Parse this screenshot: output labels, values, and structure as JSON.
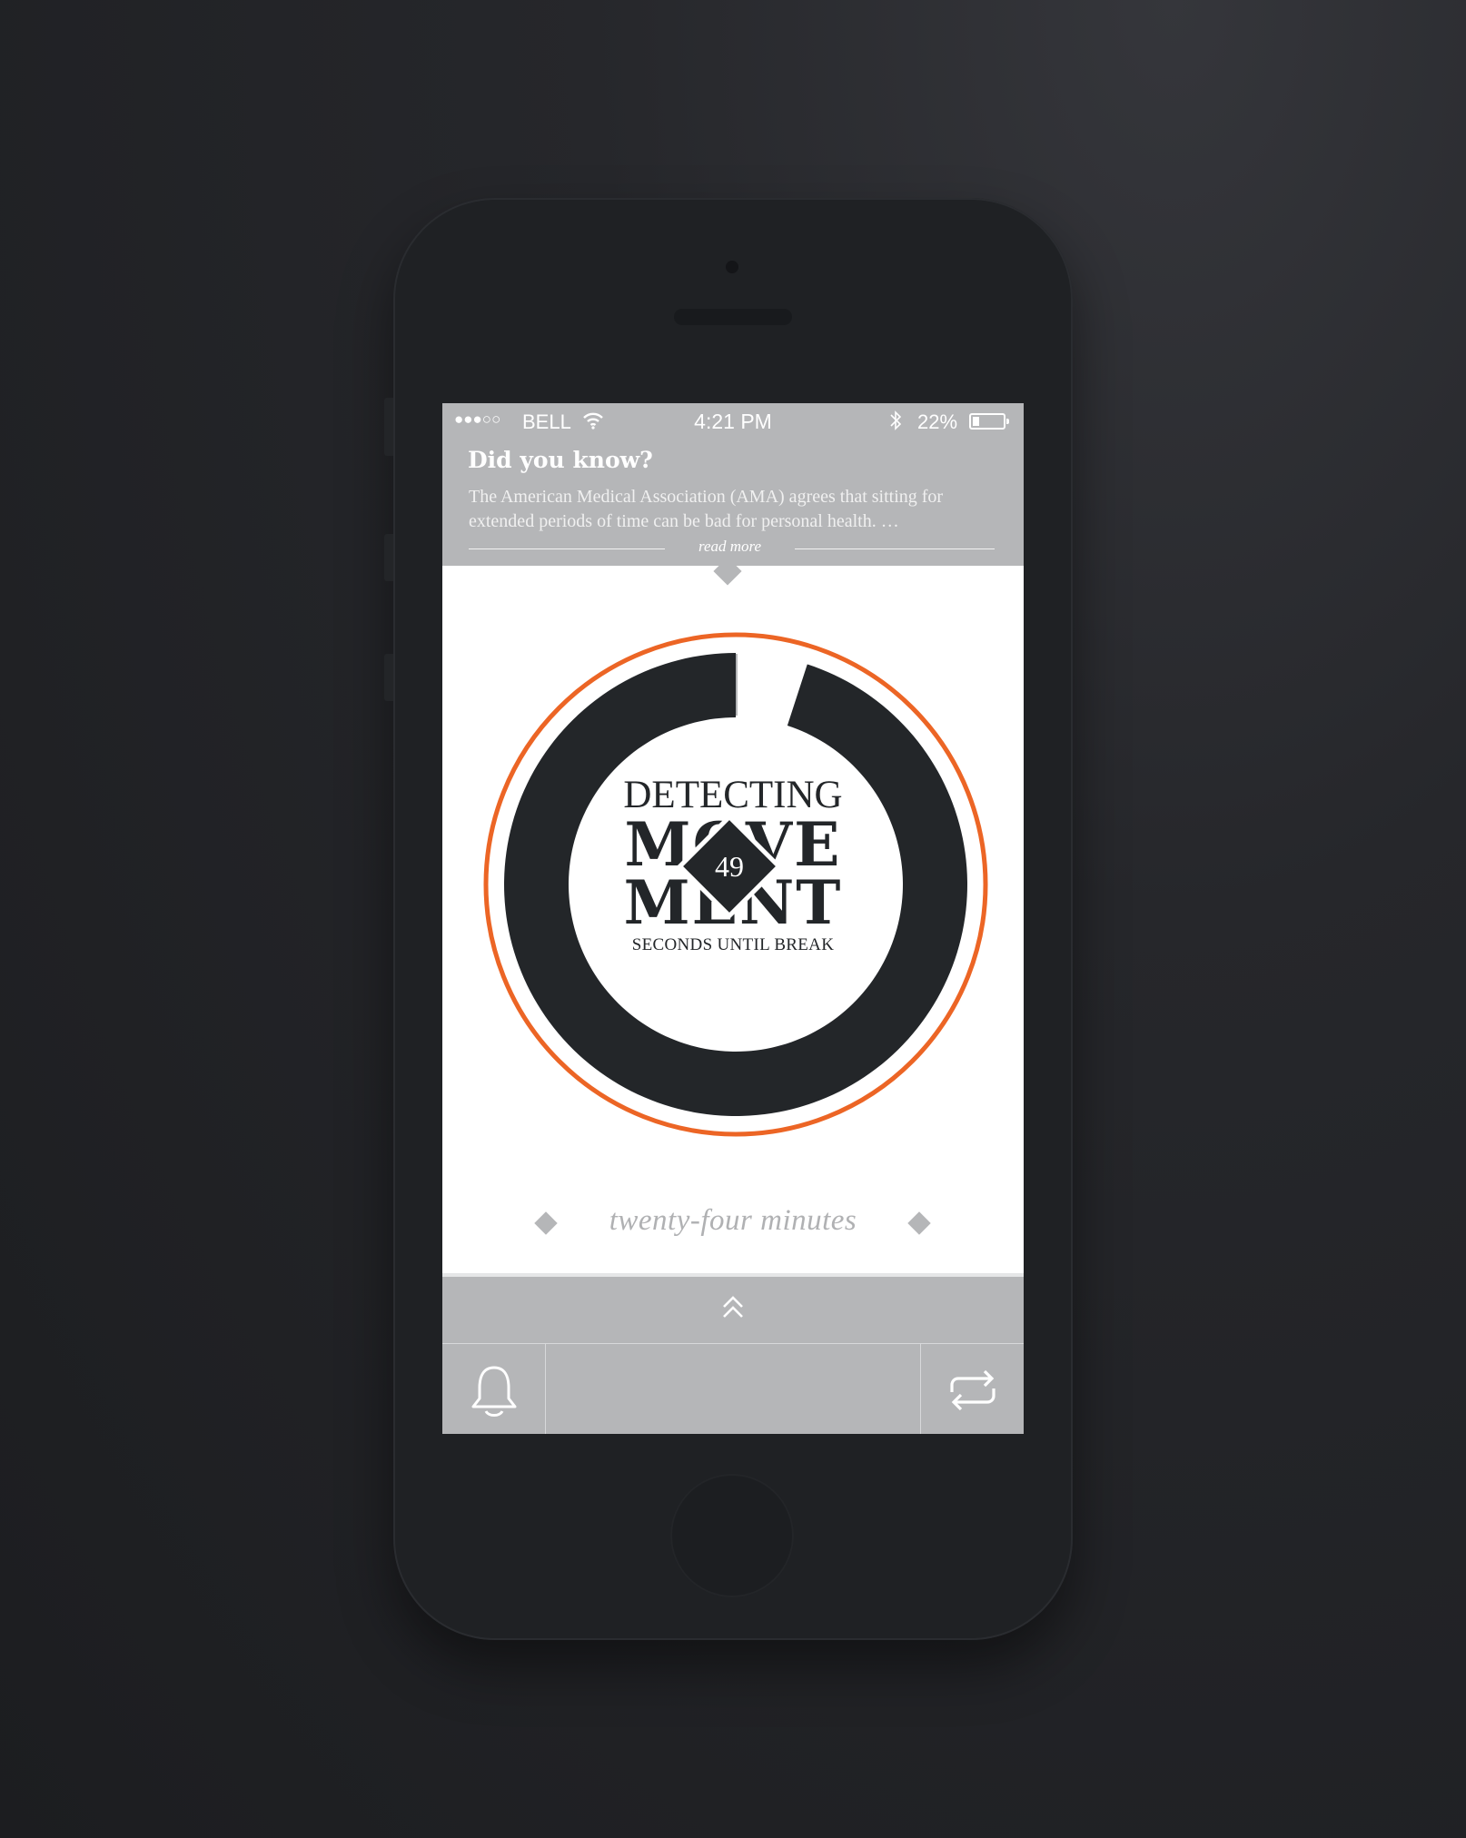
{
  "status_bar": {
    "signal": "●●●○○",
    "carrier": "BELL",
    "time": "4:21 PM",
    "battery_percent": "22%",
    "battery_level": 0.22
  },
  "tip": {
    "title": "Did you know?",
    "body": "The American Medical Association (AMA) agrees that sitting for extended periods of time can be bad for personal health. …",
    "read_more": "read more"
  },
  "timer": {
    "line1": "DETECTING",
    "line2": "MOVE",
    "line3": "MENT",
    "line4": "SECONDS UNTIL BREAK",
    "seconds_remaining": "49",
    "progress_remaining": 0.95
  },
  "duration": {
    "label": "twenty-four minutes"
  },
  "toolbar": {
    "expand_icon": "double-chevron-up-icon",
    "alarm_icon": "bell-icon",
    "repeat_icon": "repeat-icon"
  },
  "colors": {
    "accent": "#ec6525",
    "ring": "#232629",
    "panel_gray": "#b5b6b8"
  }
}
